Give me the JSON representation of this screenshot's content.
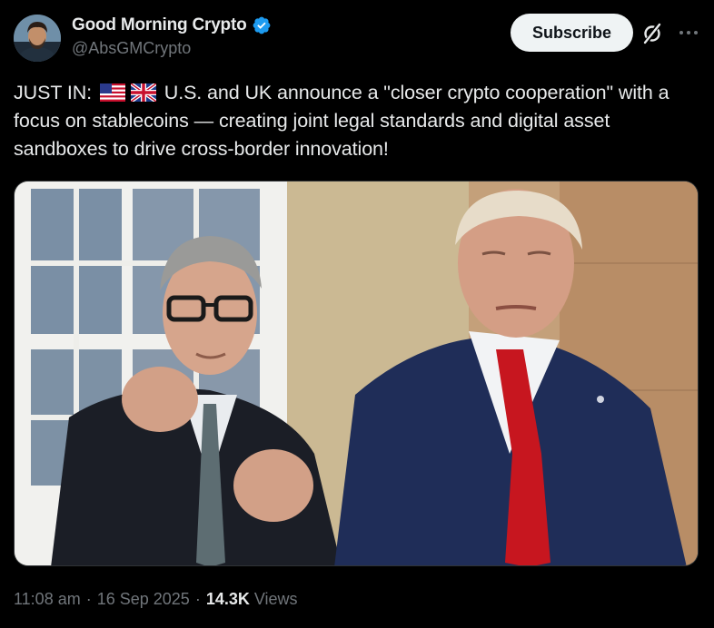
{
  "author": {
    "display_name": "Good Morning Crypto",
    "handle": "@AbsGMCrypto",
    "verified": true
  },
  "actions": {
    "subscribe_label": "Subscribe",
    "grok_icon": "grok-icon",
    "more_icon": "more-icon"
  },
  "tweet": {
    "prefix": "JUST IN:",
    "flags": [
      "us-flag-icon",
      "uk-flag-icon"
    ],
    "text_line": "U.S. and UK announce a \"closer crypto cooperation\" with a focus on stablecoins — creating joint legal standards and digital asset sandboxes to drive cross-border innovation!"
  },
  "meta": {
    "time": "11:08 am",
    "date": "16 Sep 2025",
    "views_count": "14.3K",
    "views_label": "Views"
  },
  "colors": {
    "background": "#000000",
    "text": "#e7e9ea",
    "secondary": "#71767b",
    "verified": "#1d9bf0"
  }
}
